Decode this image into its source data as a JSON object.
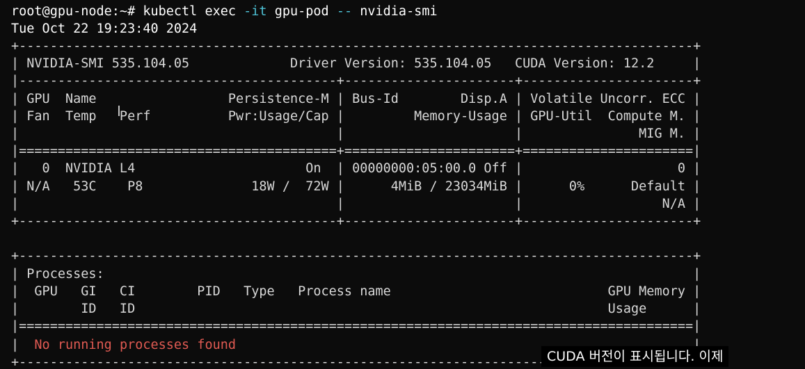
{
  "terminal": {
    "prev_line_fragment": "root@gpu-node:",
    "command": {
      "prompt": "root@gpu-node:~# ",
      "base": "kubectl exec ",
      "flag1": "-it",
      "pod": " gpu-pod ",
      "flag2": "--",
      "program": " nvidia-smi"
    },
    "timestamp": "Tue Oct 22 19:23:40 2024",
    "smi_lines": [
      "+---------------------------------------------------------------------------------------+",
      "| NVIDIA-SMI 535.104.05             Driver Version: 535.104.05   CUDA Version: 12.2     |",
      "|-----------------------------------------+----------------------+----------------------+",
      "| GPU  Name                 Persistence-M | Bus-Id        Disp.A | Volatile Uncorr. ECC |",
      "| Fan  Temp   Perf          Pwr:Usage/Cap |         Memory-Usage | GPU-Util  Compute M. |",
      "|                                         |                      |               MIG M. |",
      "|=========================================+======================+======================|",
      "|   0  NVIDIA L4                      On  | 00000000:05:00.0 Off |                    0 |",
      "| N/A   53C    P8              18W /  72W |      4MiB / 23034MiB |      0%      Default |",
      "|                                         |                      |                  N/A |",
      "+-----------------------------------------+----------------------+----------------------+",
      "",
      "+---------------------------------------------------------------------------------------+",
      "| Processes:                                                                            |",
      "|  GPU   GI   CI        PID   Type   Process name                            GPU Memory |",
      "|        ID   ID                                                             Usage      |",
      "|=======================================================================================|"
    ],
    "no_proc": {
      "prefix": "|  ",
      "message": "No running processes found",
      "suffix": "                                                           |"
    },
    "bottom_border": "+---------------------------------------------------------------------------------------+",
    "colors": {
      "background": "#0c0c0c",
      "text": "#d8d8d8",
      "flag": "#4ec2d6",
      "error": "#e05a52"
    }
  },
  "subtitle": "CUDA 버전이 표시됩니다. 이제"
}
